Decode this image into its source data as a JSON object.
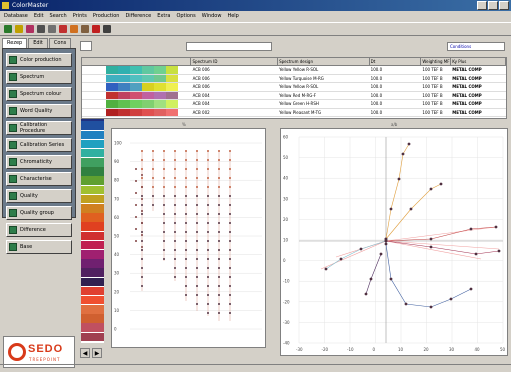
{
  "window": {
    "title": "ColorMaster"
  },
  "menu": [
    "Database",
    "Edit",
    "Search",
    "Prints",
    "Production",
    "Difference",
    "Extra",
    "Options",
    "Window",
    "Help"
  ],
  "toolbar_icons": [
    {
      "name": "save-icon",
      "color": "#2a7a2a"
    },
    {
      "name": "open-icon",
      "color": "#c0a000"
    },
    {
      "name": "color-wheel-icon",
      "color": "#b03060"
    },
    {
      "name": "print-icon",
      "color": "#505050"
    },
    {
      "name": "print-preview-icon",
      "color": "#707070"
    },
    {
      "name": "filter-icon",
      "color": "#c03030"
    },
    {
      "name": "filter-add-icon",
      "color": "#d07020"
    },
    {
      "name": "recipe-icon",
      "color": "#806040"
    },
    {
      "name": "palette-icon",
      "color": "#c02020"
    },
    {
      "name": "settings-icon",
      "color": "#404040"
    }
  ],
  "tabs": [
    "Rezep",
    "Edit",
    "Cons"
  ],
  "nav": [
    "Color production",
    "Spectrum",
    "Spectrum colour",
    "Word Quality",
    "Calibration Procedure",
    "Calibration Series",
    "Chromaticity",
    "Characterise",
    "Quality",
    "Quality group",
    "Difference",
    "Base"
  ],
  "mode_select": "Conditions",
  "table": {
    "headers": [
      "",
      "Spectrum ID",
      "Spectrum design",
      "Dt",
      "Weighting MF",
      "Ky Plus"
    ],
    "rows": [
      {
        "id": "ACB 006",
        "design": "Yellow Yellow R-SOL",
        "val": "100.0",
        "code": "100 TEF B",
        "company": "METAL COMP"
      },
      {
        "id": "ACB 006",
        "design": "Yellow Turquoise M-RG",
        "val": "100.0",
        "code": "100 TEF B",
        "company": "METAL COMP"
      },
      {
        "id": "ACB 006",
        "design": "Yellow Yellow R-SOL",
        "val": "100.0",
        "code": "100 TEF B",
        "company": "METAL COMP"
      },
      {
        "id": "ACB 004",
        "design": "Yellow Red M-RG-F",
        "val": "100.0",
        "code": "100 TEF B",
        "company": "METAL COMP"
      },
      {
        "id": "ACB 004",
        "design": "Yellow Green H-RSH",
        "val": "100.0",
        "code": "100 TEF B",
        "company": "METAL COMP"
      },
      {
        "id": "ACB 002",
        "design": "Yellow Pleasant M-TG",
        "val": "100.0",
        "code": "100 TEF B",
        "company": "METAL COMP"
      }
    ],
    "row_bars": [
      [
        "#30b0a0",
        "#30b0b0",
        "#40c0b0",
        "#60c8a0",
        "#70d090",
        "#c8e040"
      ],
      [
        "#40b0c0",
        "#40b0c0",
        "#50c0c0",
        "#60c8b0",
        "#70c890",
        "#d8e040"
      ],
      [
        "#3060c0",
        "#4080c0",
        "#50a0c0",
        "#d8d020",
        "#e0e030",
        "#f0f050"
      ],
      [
        "#c03030",
        "#c04060",
        "#d05070",
        "#c060a0",
        "#b070b0",
        "#a07090"
      ],
      [
        "#50b040",
        "#60c050",
        "#70d060",
        "#80d070",
        "#a0e080",
        "#d0f060"
      ],
      [
        "#b02020",
        "#c03030",
        "#d04040",
        "#e05050",
        "#e06060",
        "#f07070"
      ]
    ]
  },
  "swatches": [
    "#d02020",
    "#e04020",
    "#d83060",
    "#b02060",
    "#802040",
    "#502030",
    "#203080",
    "#2050a0",
    "#2080c0",
    "#20a0c0",
    "#30b0a0",
    "#40a060",
    "#308040",
    "#60a030",
    "#a0c030",
    "#c0a020",
    "#d08020",
    "#e06020",
    "#e04020",
    "#d03030",
    "#c02050",
    "#a02070",
    "#702070",
    "#502060",
    "#302050",
    "#e04030",
    "#f05030",
    "#e07040",
    "#d06030",
    "#c05060",
    "#a04050"
  ],
  "left_chart": {
    "title": "%",
    "y_ticks": [
      "100",
      "90",
      "80",
      "70",
      "60",
      "50",
      "40",
      "30",
      "20",
      "10",
      "0"
    ]
  },
  "right_chart": {
    "title": "a/b",
    "x_ticks": [
      "-30",
      "-20",
      "-10",
      "0",
      "10",
      "20",
      "30",
      "40",
      "50"
    ],
    "y_ticks": [
      "60",
      "50",
      "40",
      "30",
      "20",
      "10",
      "0",
      "-10",
      "-20",
      "-30",
      "-40"
    ]
  },
  "logo": {
    "text": "SEDO",
    "sub": "TREEPOINT"
  },
  "nav_arrows": [
    "◀",
    "▶"
  ]
}
